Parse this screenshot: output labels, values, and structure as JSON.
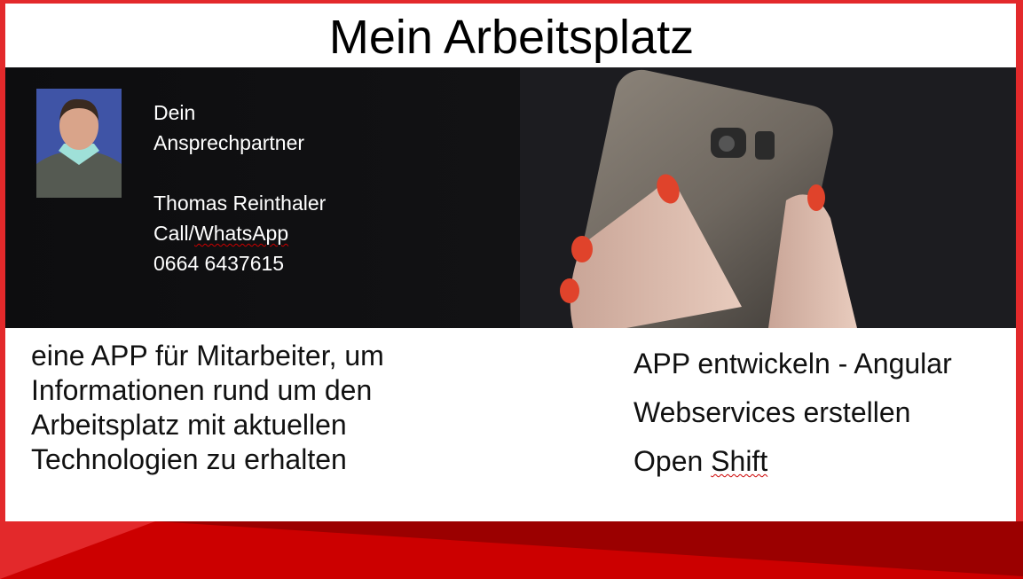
{
  "title": "Mein Arbeitsplatz",
  "contact": {
    "line1": "Dein",
    "line2": "Ansprechpartner",
    "name": "Thomas Reinthaler",
    "call_prefix": "Call/",
    "call_app": "WhatsApp",
    "phone": "0664 6437615"
  },
  "description": "eine APP für Mitarbeiter, um Informationen rund um den Arbeitsplatz mit aktuellen Technologien zu erhalten",
  "tasks": [
    {
      "prefix": "APP entwickeln - Angular",
      "suffix": ""
    },
    {
      "prefix": "Webservices erstellen",
      "suffix": ""
    },
    {
      "prefix": "Open ",
      "suffix": "Shift"
    }
  ],
  "colors": {
    "red_light": "#e3292b",
    "red_mid": "#cc0000",
    "red_dark": "#9b0000"
  }
}
